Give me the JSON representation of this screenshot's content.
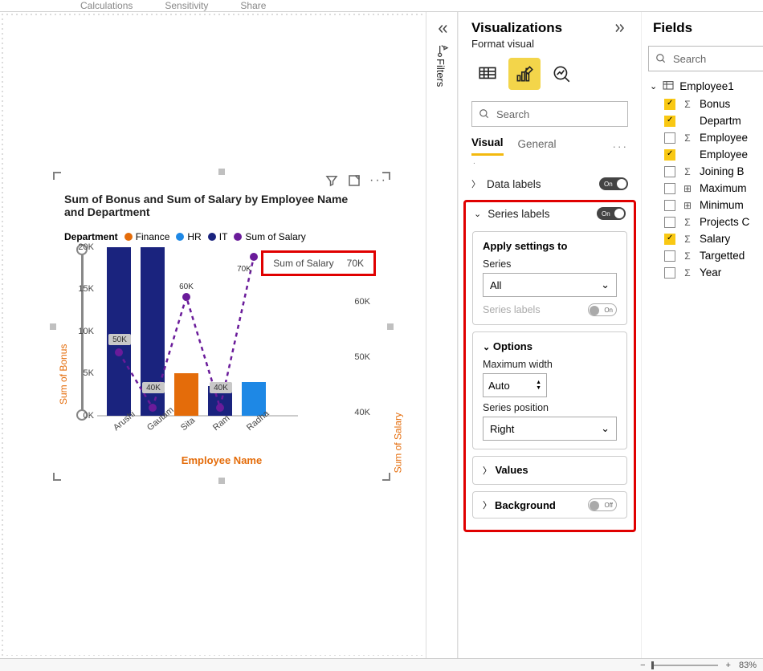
{
  "ribbon": {
    "calculations": "Calculations",
    "sensitivity": "Sensitivity",
    "share": "Share"
  },
  "filters_label": "Filters",
  "vis": {
    "title": "Visualizations",
    "subtitle": "Format visual",
    "search_placeholder": "Search",
    "tab_visual": "Visual",
    "tab_general": "General",
    "data_labels": "Data labels",
    "series_labels": "Series labels",
    "apply_settings": "Apply settings to",
    "series_label": "Series",
    "series_value": "All",
    "series_labels_sub": "Series labels",
    "options": "Options",
    "max_width": "Maximum width",
    "max_width_value": "Auto",
    "series_position": "Series position",
    "series_position_value": "Right",
    "values": "Values",
    "background": "Background"
  },
  "fields": {
    "title": "Fields",
    "search_placeholder": "Search",
    "table": "Employee1",
    "items": [
      {
        "label": "Bonus",
        "checked": true,
        "icon": "Σ"
      },
      {
        "label": "Departm",
        "checked": true,
        "icon": ""
      },
      {
        "label": "Employee",
        "checked": false,
        "icon": "Σ"
      },
      {
        "label": "Employee",
        "checked": true,
        "icon": ""
      },
      {
        "label": "Joining B",
        "checked": false,
        "icon": "Σ"
      },
      {
        "label": "Maximum",
        "checked": false,
        "icon": "⊞"
      },
      {
        "label": "Minimum",
        "checked": false,
        "icon": "⊞"
      },
      {
        "label": "Projects C",
        "checked": false,
        "icon": "Σ"
      },
      {
        "label": "Salary",
        "checked": true,
        "icon": "Σ"
      },
      {
        "label": "Targetted",
        "checked": false,
        "icon": "Σ"
      },
      {
        "label": "Year",
        "checked": false,
        "icon": "Σ"
      }
    ]
  },
  "chart": {
    "title": "Sum of Bonus and Sum of Salary by Employee Name and Department",
    "legend_title": "Department",
    "legend": [
      {
        "name": "Finance",
        "color": "#e46c0a"
      },
      {
        "name": "HR",
        "color": "#1e88e5"
      },
      {
        "name": "IT",
        "color": "#1a237e"
      },
      {
        "name": "Sum of Salary",
        "color": "#6a1b9a"
      }
    ],
    "series_tag_label": "Sum of Salary",
    "series_tag_value": "70K",
    "y_left_ticks": [
      "20K",
      "15K",
      "10K",
      "5K",
      "0K"
    ],
    "y_right_ticks": [
      "60K",
      "50K",
      "40K"
    ],
    "xlabels": [
      "Arushi",
      "Gautam",
      "Sita",
      "Ram",
      "Radha"
    ],
    "y_left_title": "Sum of Bonus",
    "y_right_title": "Sum of Salary",
    "x_title": "Employee Name"
  },
  "zoom": "83%",
  "chart_data": {
    "type": "bar",
    "title": "Sum of Bonus and Sum of Salary by Employee Name and Department",
    "categories": [
      "Arushi",
      "Gautam",
      "Sita",
      "Ram",
      "Radha"
    ],
    "departments": [
      "IT",
      "IT",
      "Finance",
      "IT",
      "HR"
    ],
    "series": [
      {
        "name": "Sum of Bonus",
        "axis": "left",
        "values": [
          20000,
          20000,
          5000,
          3500,
          4000
        ]
      },
      {
        "name": "Sum of Salary",
        "axis": "right",
        "values": [
          50000,
          40000,
          60000,
          40000,
          70000
        ],
        "labels": [
          "50K",
          "40K",
          "60K",
          "40K",
          "70K"
        ]
      }
    ],
    "xlabel": "Employee Name",
    "y_left_label": "Sum of Bonus",
    "y_right_label": "Sum of Salary",
    "y_left_range": [
      0,
      20000
    ],
    "y_right_range": [
      40000,
      70000
    ]
  }
}
